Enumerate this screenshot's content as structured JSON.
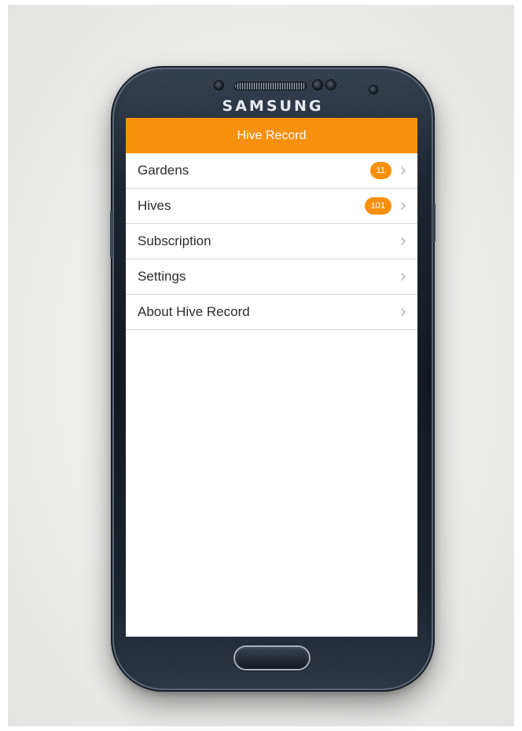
{
  "device": {
    "brand": "SAMSUNG"
  },
  "app": {
    "title": "Hive Record",
    "accent_color": "#f7900c"
  },
  "menu": {
    "items": [
      {
        "label": "Gardens",
        "badge": "11",
        "icon": "chevron-right-icon"
      },
      {
        "label": "Hives",
        "badge": "101",
        "icon": "chevron-right-icon"
      },
      {
        "label": "Subscription",
        "badge": null,
        "icon": "chevron-right-icon"
      },
      {
        "label": "Settings",
        "badge": null,
        "icon": "chevron-right-icon"
      },
      {
        "label": "About Hive Record",
        "badge": null,
        "icon": "chevron-right-icon"
      }
    ]
  }
}
